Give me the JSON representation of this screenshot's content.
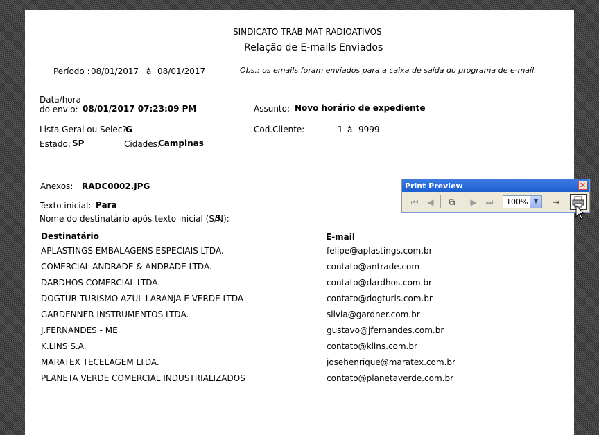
{
  "report": {
    "org_name": "SINDICATO TRAB MAT RADIOATIVOS",
    "title": "Relação de E-mails Enviados",
    "period_label": "Período :",
    "period_start": "08/01/2017",
    "period_sep": "à",
    "period_end": "08/01/2017",
    "obs": "Obs.: os emails foram enviados para a caixa de saída do programa de e-mail.",
    "datahora_label_1": "Data/hora",
    "datahora_label_2": "do envio:",
    "datahora_value": "08/01/2017 07:23:09 PM",
    "assunto_label": "Assunto:",
    "assunto_value": "Novo horário de expediente",
    "lista_label": "Lista Geral ou Selec?:",
    "lista_value": "G",
    "codcliente_label": "Cod.Cliente:",
    "codcliente_from": "1",
    "codcliente_sep": "à",
    "codcliente_to": "9999",
    "estado_label": "Estado:",
    "estado_value": "SP",
    "cidades_label": "Cidades:",
    "cidades_value": "Campinas",
    "anexos_label": "Anexos:",
    "anexos_value": "RADC0002.JPG",
    "texto_label": "Texto inicial:",
    "texto_value": "Para",
    "nome_label": "Nome do destinatário após texto inicial (S/N):",
    "nome_value": "S",
    "col_destinatario": "Destinatário",
    "col_email": "E-mail",
    "rows": [
      {
        "name": "APLASTINGS EMBALAGENS ESPECIAIS LTDA.",
        "email": "felipe@aplastings.com.br"
      },
      {
        "name": "COMERCIAL ANDRADE & ANDRADE LTDA.",
        "email": "contato@antrade.com"
      },
      {
        "name": "DARDHOS COMERCIAL LTDA.",
        "email": "contato@dardhos.com.br"
      },
      {
        "name": "DOGTUR TURISMO AZUL LARANJA E VERDE LTDA",
        "email": "contato@dogturis.com.br"
      },
      {
        "name": "GARDENNER INSTRUMENTOS LTDA.",
        "email": "silvia@gardner.com.br"
      },
      {
        "name": "J.FERNANDES - ME",
        "email": "gustavo@jfernandes.com.br"
      },
      {
        "name": "K.LINS S.A.",
        "email": "contato@klins.com.br"
      },
      {
        "name": "MARATEX TECELAGEM LTDA.",
        "email": "josehenrique@maratex.com.br"
      },
      {
        "name": "PLANETA VERDE COMERCIAL INDUSTRIALIZADOS",
        "email": "contato@planetaverde.com.br"
      }
    ]
  },
  "print_preview": {
    "title": "Print Preview",
    "zoom": "100%",
    "icons": [
      "first-page-icon",
      "prev-page-icon",
      "multi-page-icon",
      "next-page-icon",
      "last-page-icon",
      "zoom-dropdown-icon",
      "close-preview-icon",
      "print-icon"
    ]
  }
}
